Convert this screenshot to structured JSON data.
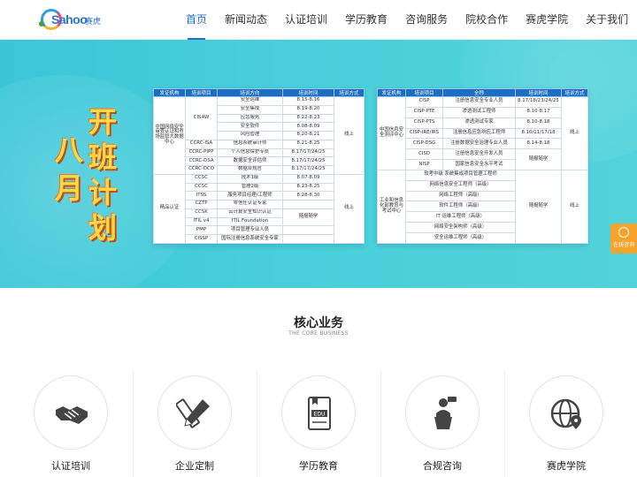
{
  "logo": {
    "text": "Sahoo",
    "cn": "赛虎"
  },
  "nav": {
    "items": [
      {
        "label": "首页",
        "active": true
      },
      {
        "label": "新闻动态",
        "active": false
      },
      {
        "label": "认证培训",
        "active": false
      },
      {
        "label": "学历教育",
        "active": false
      },
      {
        "label": "咨询服务",
        "active": false
      },
      {
        "label": "院校合作",
        "active": false
      },
      {
        "label": "赛虎学院",
        "active": false
      },
      {
        "label": "关于我们",
        "active": false
      }
    ]
  },
  "banner": {
    "words": {
      "ba": "八",
      "yue": "月",
      "kai": "开",
      "ban": "班",
      "ji": "计",
      "hua": "划"
    },
    "table_left": {
      "headers": [
        "发证机构",
        "培训项目",
        "培训方向",
        "培训时间",
        "培训方式"
      ],
      "org1": "中国网络安全审查认证和市场监管大数据中心",
      "org2": "精品认证",
      "cisaw": "CISAW",
      "mode_online": "线上",
      "mode_online2": "线上",
      "rows": [
        {
          "project": "",
          "direction": "安全运维",
          "time": "8.15-8.16"
        },
        {
          "project": "",
          "direction": "安全集成",
          "time": "8.19-8.20"
        },
        {
          "project": "",
          "direction": "应急服务",
          "time": "8.22-8.23"
        },
        {
          "project": "",
          "direction": "安全软件",
          "time": "8.08-8.09"
        },
        {
          "project": "",
          "direction": "风险管理",
          "time": "8.20-8.21"
        },
        {
          "project": "CCRC-ISA",
          "direction": "信息系统审计师",
          "time": "8.21-8.25"
        },
        {
          "project": "CCRC-PIPP",
          "direction": "个人信息保护专员",
          "time": "8.17/17/24/25"
        },
        {
          "project": "CCRC-DSA",
          "direction": "数据安全评估师",
          "time": "8.17/17/24/25"
        },
        {
          "project": "CCRC-DCO",
          "direction": "数据合规官",
          "time": "8.17/17/24/25"
        },
        {
          "project": "CCSC",
          "direction": "技术1级",
          "time": "8.07-8.09"
        },
        {
          "project": "CCSC",
          "direction": "管理2级",
          "time": "8.23-8.25"
        },
        {
          "project": "ITSS",
          "direction": "服务项目经理/工程师",
          "time": "8.28-8.30"
        },
        {
          "project": "CZTP",
          "direction": "零信任认证专家",
          "time": ""
        },
        {
          "project": "CCSK",
          "direction": "云计算安全知识认证",
          "time": ""
        },
        {
          "project": "ITIL v4",
          "direction": "ITIL Foundation",
          "time": "随报随学"
        },
        {
          "project": "PMP",
          "direction": "项目管理专业人员",
          "time": ""
        },
        {
          "project": "CISSP",
          "direction": "国际注册信息系统安全专家",
          "time": ""
        }
      ]
    },
    "table_right": {
      "headers": [
        "发证机构",
        "培训项目",
        "全称",
        "培训时间",
        "培训方式"
      ],
      "org1": "中国信息安全测评中心",
      "org2": "工业和信息化部教育与考试中心",
      "mode_online": "线上",
      "mode_online2": "线上",
      "rows": [
        {
          "project": "CISP",
          "full": "注册信息安全专业人员",
          "time": "8.17/18/23/24/25"
        },
        {
          "project": "CISP-PTE",
          "full": "渗透测试工程师",
          "time": "8.10-8.17"
        },
        {
          "project": "CISP-PTS",
          "full": "渗透测试专家",
          "time": "8.10-8.18"
        },
        {
          "project": "CISP-IRE/IRS",
          "full": "注册信息应急响应工程师",
          "time": "8.10/11/17/18"
        },
        {
          "project": "CISP-DSG",
          "full": "注册数据安全治理专业人员",
          "time": "8.14-8.18"
        },
        {
          "project": "CISD",
          "full": "注册信息安全开发人员",
          "time": "随报随学"
        },
        {
          "project": "NISP",
          "full": "国家信息安全水平考试",
          "time": ""
        },
        {
          "project": "",
          "full": "软考中级 系统集成项目管理工程师",
          "time": ""
        },
        {
          "project": "",
          "full": "网络信息安全工程师（高级）",
          "time": ""
        },
        {
          "project": "",
          "full": "网络工程师（高级）",
          "time": ""
        },
        {
          "project": "",
          "full": "软件工程师（高级）",
          "time": "随报随学"
        },
        {
          "project": "",
          "full": "IT 运维工程师（高级）",
          "time": ""
        },
        {
          "project": "",
          "full": "网络安全架构师（高级）",
          "time": ""
        },
        {
          "project": "",
          "full": "安全运维工程师（高级）",
          "time": ""
        }
      ]
    }
  },
  "consult": {
    "label": "在线咨询",
    "icon": "headset-icon"
  },
  "core": {
    "title": "核心业务",
    "subtitle": "THE CORE BUSINESS",
    "items": [
      {
        "label": "认证培训",
        "icon": "handshake-icon"
      },
      {
        "label": "企业定制",
        "icon": "pencil-ruler-icon"
      },
      {
        "label": "学历教育",
        "icon": "edu-book-icon"
      },
      {
        "label": "合规咨询",
        "icon": "speaker-podium-icon"
      },
      {
        "label": "赛虎学院",
        "icon": "globe-location-icon"
      }
    ]
  },
  "colors": {
    "primary": "#1f6fc7",
    "banner": "#48cfd9",
    "accent": "#f5a32a",
    "title_yellow": "#ffd84a"
  }
}
